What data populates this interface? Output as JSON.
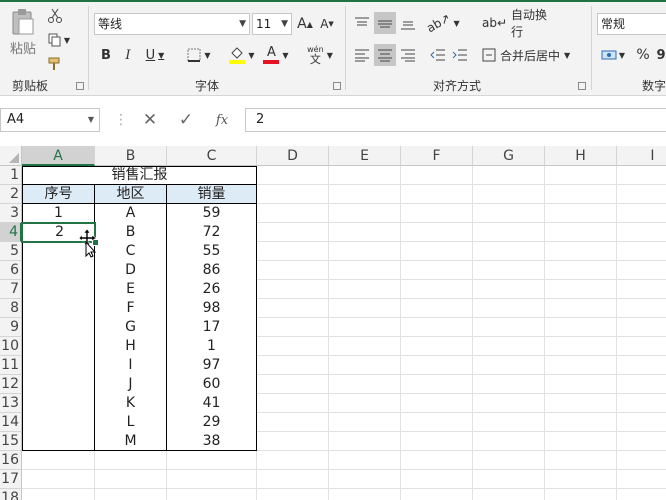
{
  "ribbon": {
    "clipboard": {
      "paste_label": "粘贴",
      "group_label": "剪贴板"
    },
    "font": {
      "font_name": "等线",
      "font_size": "11",
      "bold": "B",
      "italic": "I",
      "underline": "U",
      "wen_label": "wén",
      "wen_char": "文",
      "group_label": "字体"
    },
    "alignment": {
      "wrap_text": "自动换行",
      "merge_center": "合并后居中",
      "group_label": "对齐方式"
    },
    "number": {
      "format": "常规",
      "percent": "%",
      "comma": "9",
      "group_label": "数字"
    }
  },
  "formula_bar": {
    "name_box": "A4",
    "fx": "fx",
    "value": "2"
  },
  "sheet": {
    "columns": [
      "A",
      "B",
      "C",
      "D",
      "E",
      "F",
      "G",
      "H",
      "I"
    ],
    "rows": [
      "1",
      "2",
      "3",
      "4",
      "5",
      "6",
      "7",
      "8",
      "9",
      "10",
      "11",
      "12",
      "13",
      "14",
      "15",
      "16",
      "17",
      "18"
    ],
    "title": "销售汇报",
    "headers": [
      "序号",
      "地区",
      "销量"
    ],
    "a_values": [
      "1",
      "2"
    ],
    "regions": [
      "A",
      "B",
      "C",
      "D",
      "E",
      "F",
      "G",
      "H",
      "I",
      "J",
      "K",
      "L",
      "M"
    ],
    "sales": [
      "59",
      "72",
      "55",
      "86",
      "26",
      "98",
      "17",
      "1",
      "97",
      "60",
      "41",
      "29",
      "38"
    ]
  },
  "colors": {
    "accent": "#217346",
    "header_fill": "#ddebf7",
    "selection": "#217346",
    "font_color_bar": "#e81123",
    "fill_color_bar": "#ffff00"
  }
}
